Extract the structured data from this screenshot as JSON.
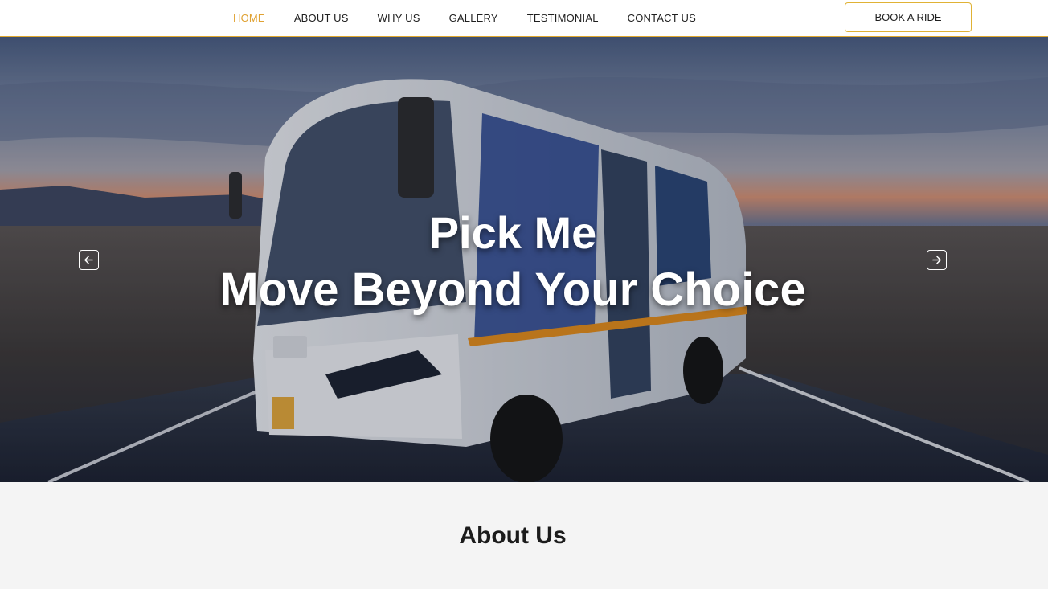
{
  "nav": {
    "links": [
      {
        "label": "HOME",
        "active": true
      },
      {
        "label": "ABOUT US",
        "active": false
      },
      {
        "label": "WHY US",
        "active": false
      },
      {
        "label": "GALLERY",
        "active": false
      },
      {
        "label": "TESTIMONIAL",
        "active": false
      },
      {
        "label": "CONTACT US",
        "active": false
      }
    ],
    "cta_label": "BOOK A RIDE"
  },
  "hero": {
    "title_line1": "Pick Me",
    "title_line2": "Move Beyond Your Choice",
    "prev_icon": "arrow-left-icon",
    "next_icon": "arrow-right-icon"
  },
  "about": {
    "heading": "About Us"
  },
  "colors": {
    "accent": "#e0a233",
    "nav_border": "#e0a82e",
    "text_dark": "#1f1f1f",
    "section_bg": "#f4f4f4"
  }
}
